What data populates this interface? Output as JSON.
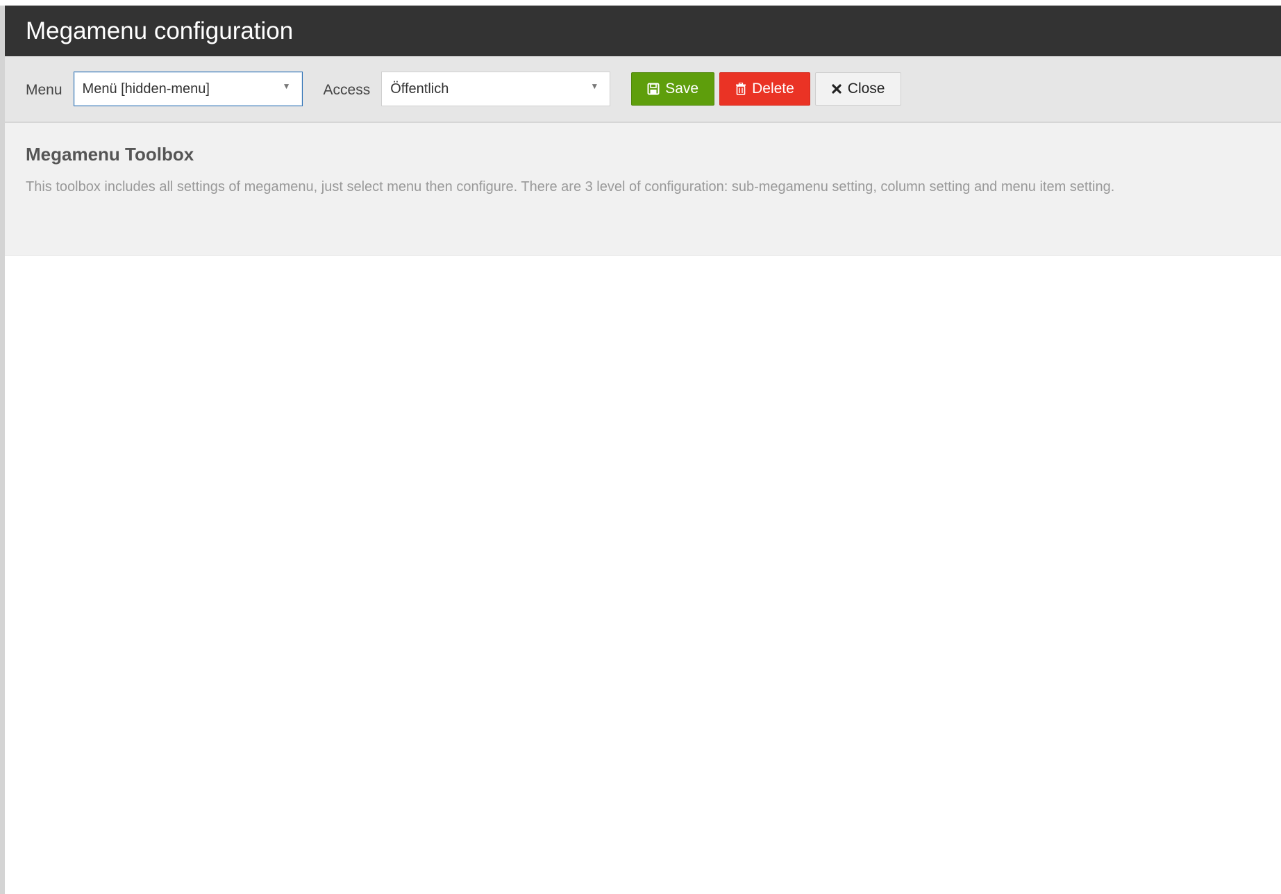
{
  "header": {
    "title": "Megamenu configuration"
  },
  "toolbar": {
    "menu_label": "Menu",
    "menu_value": "Menü [hidden-menu]",
    "access_label": "Access",
    "access_value": "Öffentlich",
    "save_label": "Save",
    "delete_label": "Delete",
    "close_label": "Close"
  },
  "toolbox": {
    "title": "Megamenu Toolbox",
    "description": "This toolbox includes all settings of megamenu, just select menu then configure. There are 3 level of configuration: sub-megamenu setting, column setting and menu item setting."
  },
  "icons": {
    "dropdown": "chevron-down-icon",
    "save": "floppy-disk-icon",
    "delete": "trash-icon",
    "close": "close-icon"
  },
  "colors": {
    "header_bg": "#333333",
    "save": "#5e9e0c",
    "delete": "#ea3325"
  }
}
